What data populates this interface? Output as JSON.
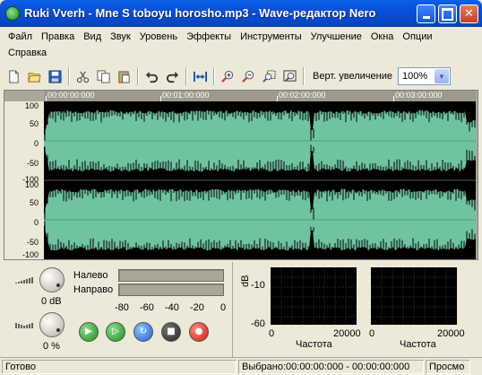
{
  "window": {
    "title": "Ruki Vverh - Mne S toboyu horosho.mp3 - Wave-редактор Nero"
  },
  "menu": {
    "items": [
      "Файл",
      "Правка",
      "Вид",
      "Звук",
      "Уровень",
      "Эффекты",
      "Инструменты",
      "Улучшение",
      "Окна",
      "Опции"
    ],
    "items_row2": [
      "Справка"
    ]
  },
  "toolbar": {
    "icons": [
      "new-file-icon",
      "open-folder-icon",
      "save-icon",
      "cut-icon",
      "copy-icon",
      "paste-icon",
      "undo-icon",
      "redo-icon",
      "fit-width-icon",
      "zoom-in-icon",
      "zoom-out-icon",
      "zoom-selection-icon",
      "zoom-all-icon"
    ],
    "zoom_label": "Верт. увеличение",
    "zoom_value": "100%"
  },
  "editor": {
    "ruler": [
      "00:00:00:000",
      "00:01:00:000",
      "00:02:00:000",
      "00:03:00:000"
    ],
    "y_labels_channel1": [
      "100",
      "50",
      "0",
      "-50",
      "-100"
    ],
    "y_labels_channel2": [
      "100",
      "50",
      "0",
      "-50",
      "-100"
    ],
    "wave_color": "#6fc4a0",
    "background_color": "#000000"
  },
  "controls": {
    "volume_label": "0 dB",
    "pan_label": "0 %",
    "meter_left_label": "Налево",
    "meter_right_label": "Направо",
    "meter_scale": [
      "-80",
      "-60",
      "-40",
      "-20",
      "0"
    ],
    "play_icons": [
      "play-icon",
      "play-selection-icon",
      "loop-icon",
      "stop-icon",
      "record-icon"
    ]
  },
  "spectrum": {
    "ylabel": "dB",
    "y_ticks": [
      "-10",
      "-60"
    ],
    "x_ticks": [
      "0",
      "20000"
    ],
    "xlabel": "Частота"
  },
  "status": {
    "ready": "Готово",
    "selection": "Выбрано:00:00:00:000 - 00:00:00:000",
    "view": "Просмо"
  }
}
